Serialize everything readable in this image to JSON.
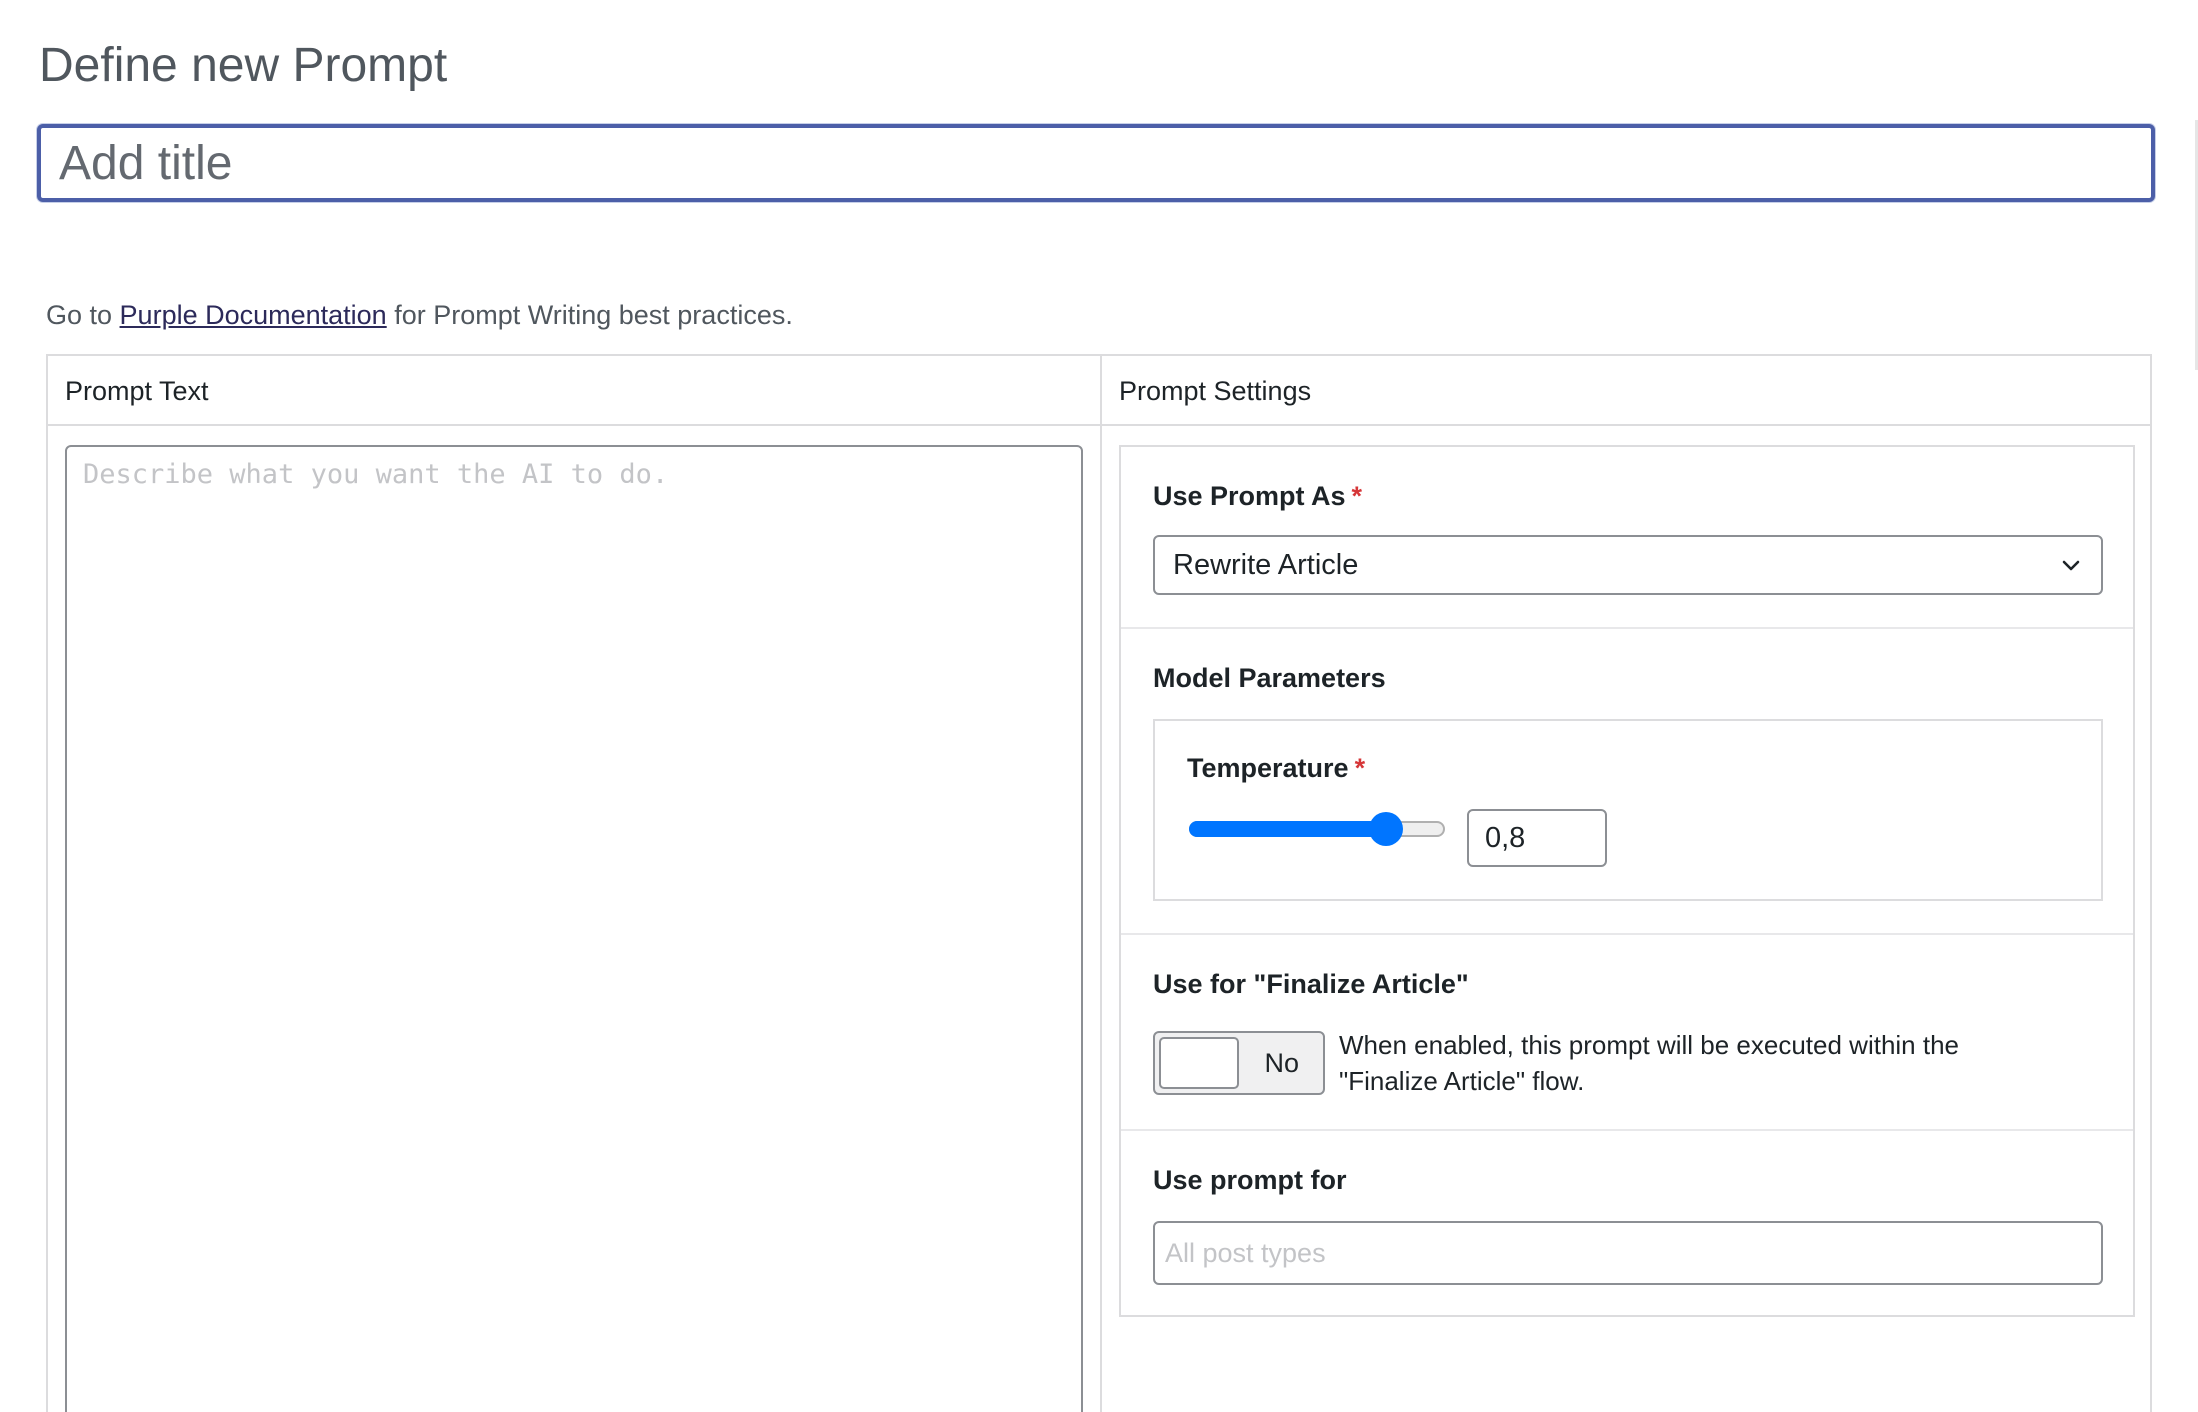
{
  "page": {
    "title": "Define new Prompt"
  },
  "title_field": {
    "value": "",
    "placeholder": "Add title"
  },
  "docs": {
    "prefix": "Go to ",
    "link_text": "Purple Documentation",
    "suffix": " for Prompt Writing best practices."
  },
  "prompt_text": {
    "header": "Prompt Text",
    "value": "",
    "placeholder": "Describe what you want the AI to do."
  },
  "settings": {
    "header": "Prompt Settings",
    "use_prompt_as": {
      "label": "Use Prompt As",
      "required_mark": "*",
      "selected": "Rewrite Article"
    },
    "model_parameters": {
      "label": "Model Parameters",
      "temperature": {
        "label": "Temperature",
        "required_mark": "*",
        "value": "0,8",
        "slider_fraction": 0.77
      }
    },
    "finalize_article": {
      "label": "Use for \"Finalize Article\"",
      "toggle_state": "No",
      "description": "When enabled, this prompt will be executed within the \"Finalize Article\" flow."
    },
    "use_prompt_for": {
      "label": "Use prompt for",
      "value": "",
      "placeholder": "All post types"
    }
  },
  "colors": {
    "accent_blue": "#0075ff",
    "focus_border": "#4c5fa8",
    "required_red": "#d63638"
  }
}
